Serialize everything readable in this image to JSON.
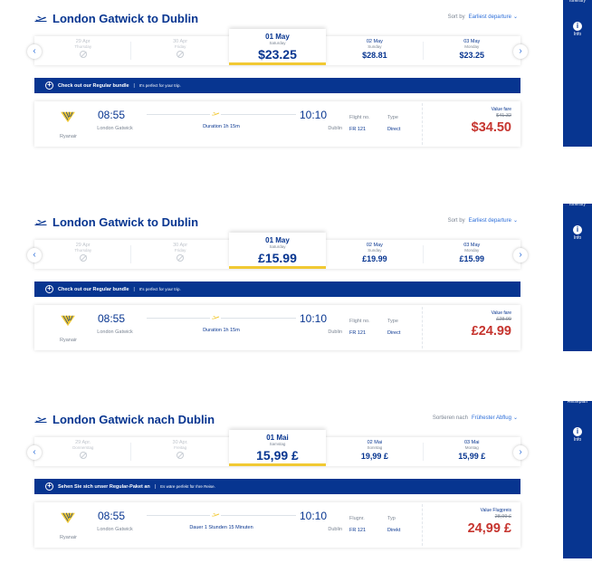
{
  "sidebar": {
    "itinerary_label": "Itinerary",
    "info_label": "Info"
  },
  "panels": [
    {
      "header": {
        "title": "London Gatwick to Dublin",
        "sort_label": "Sort by",
        "sort_value": "Earliest departure"
      },
      "dates": [
        {
          "day": "29 Apr",
          "weekday": "Thursday",
          "price": "",
          "disabled": true
        },
        {
          "day": "30 Apr",
          "weekday": "Friday",
          "price": "",
          "disabled": true
        },
        {
          "day": "01 May",
          "weekday": "Saturday",
          "price": "$23.25",
          "selected": true
        },
        {
          "day": "02 May",
          "weekday": "Sunday",
          "price": "$28.81"
        },
        {
          "day": "03 May",
          "weekday": "Monday",
          "price": "$23.25"
        }
      ],
      "bundle": {
        "title": "Check out our Regular bundle",
        "separator": "|",
        "subtitle": "It's perfect for your trip."
      },
      "flight": {
        "airline": "Ryanair",
        "dep_time": "08:55",
        "dep_place": "London Gatwick",
        "duration": "Duration 1h 15m",
        "arr_time": "10:10",
        "arr_place": "Dublin",
        "flight_no_label": "Flight no.",
        "flight_no": "FR 121",
        "type_label": "Type",
        "type": "Direct",
        "fare_label": "Value fare",
        "old_price": "$41.32",
        "price": "$34.50"
      }
    },
    {
      "header": {
        "title": "London Gatwick to Dublin",
        "sort_label": "Sort by",
        "sort_value": "Earliest departure"
      },
      "dates": [
        {
          "day": "29 Apr",
          "weekday": "Thursday",
          "price": "",
          "disabled": true
        },
        {
          "day": "30 Apr",
          "weekday": "Friday",
          "price": "",
          "disabled": true
        },
        {
          "day": "01 May",
          "weekday": "Saturday",
          "price": "£15.99",
          "selected": true
        },
        {
          "day": "02 May",
          "weekday": "Sunday",
          "price": "£19.99"
        },
        {
          "day": "03 May",
          "weekday": "Monday",
          "price": "£15.99"
        }
      ],
      "bundle": {
        "title": "Check out our Regular bundle",
        "separator": "|",
        "subtitle": "It's perfect for your trip."
      },
      "flight": {
        "airline": "Ryanair",
        "dep_time": "08:55",
        "dep_place": "London Gatwick",
        "duration": "Duration 1h 15m",
        "arr_time": "10:10",
        "arr_place": "Dublin",
        "flight_no_label": "Flight no.",
        "flight_no": "FR 121",
        "type_label": "Type",
        "type": "Direct",
        "fare_label": "Value fare",
        "old_price": "£28.99",
        "price": "£24.99"
      }
    },
    {
      "header": {
        "title": "London Gatwick nach Dublin",
        "sort_label": "Sortieren nach",
        "sort_value": "Frühester Abflug"
      },
      "dates": [
        {
          "day": "29 Apr.",
          "weekday": "Donnerstag",
          "price": "",
          "disabled": true
        },
        {
          "day": "30 Apr.",
          "weekday": "Freitag",
          "price": "",
          "disabled": true
        },
        {
          "day": "01 Mai",
          "weekday": "Samstag",
          "price": "15,99 £",
          "selected": true
        },
        {
          "day": "02 Mai",
          "weekday": "Sonntag",
          "price": "19,99 £"
        },
        {
          "day": "03 Mai",
          "weekday": "Montag",
          "price": "15,99 £"
        }
      ],
      "bundle": {
        "title": "Sehen Sie sich unser Regular-Paket an",
        "separator": "|",
        "subtitle": "Es wäre perfekt für Ihre Reise."
      },
      "flight": {
        "airline": "Ryanair",
        "dep_time": "08:55",
        "dep_place": "London Gatwick",
        "duration": "Dauer 1 Stunden 15 Minuten",
        "arr_time": "10:10",
        "arr_place": "Dublin",
        "flight_no_label": "Flugnr.",
        "flight_no": "FR 121",
        "type_label": "Typ",
        "type": "Direkt",
        "fare_label": "Value Flugpreis",
        "old_price": "28,99 £",
        "price": "24,99 £"
      }
    }
  ],
  "sidebar_labels": [
    "Itinerary",
    "Itinerary",
    "Reiseplan"
  ],
  "colors": {
    "brand_blue": "#073590",
    "accent_yellow": "#f1c933",
    "price_red": "#c6352f",
    "link_blue": "#2b6dd9"
  }
}
